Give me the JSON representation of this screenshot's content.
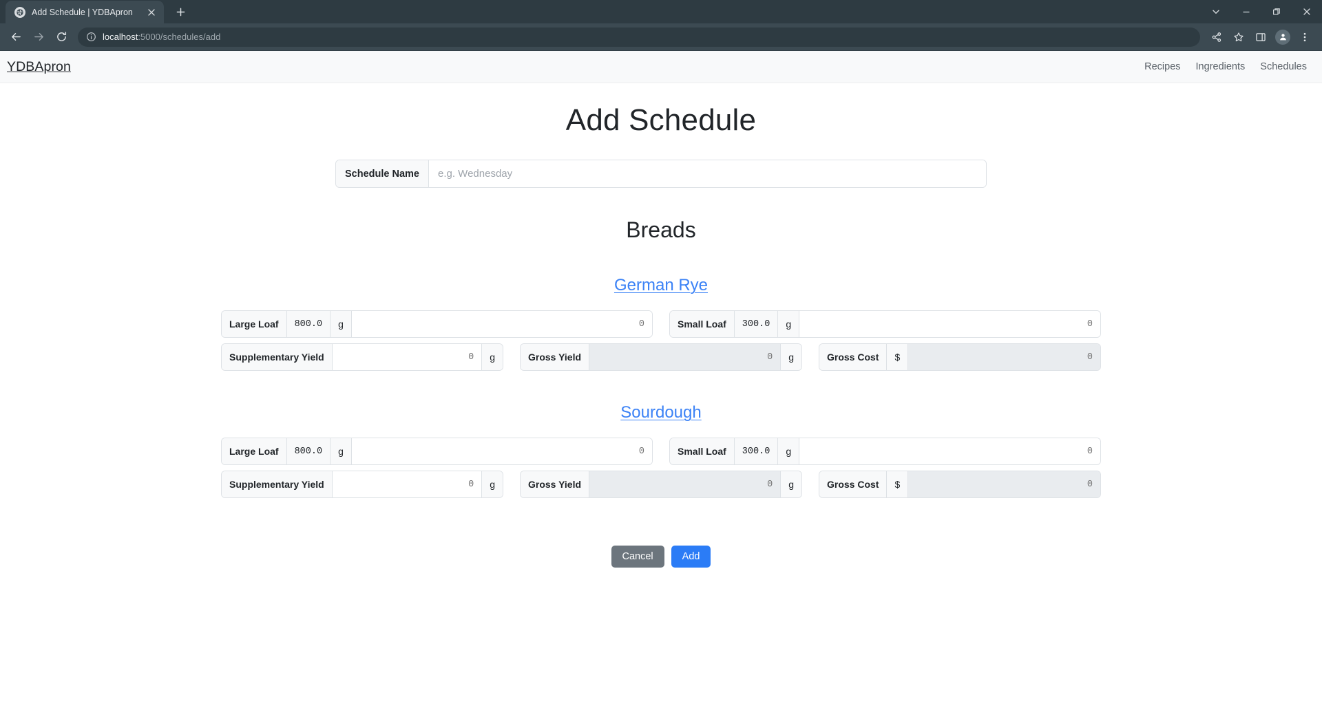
{
  "browser": {
    "tab": {
      "title": "Add Schedule | YDBApron",
      "favicon_icon": "globe-icon",
      "close_icon": "close-icon"
    },
    "new_tab_icon": "plus-icon",
    "window_controls": [
      {
        "name": "tab-search",
        "icon": "chevron-down-icon"
      },
      {
        "name": "minimize",
        "icon": "minimize-icon"
      },
      {
        "name": "maximize",
        "icon": "restore-icon"
      },
      {
        "name": "close",
        "icon": "close-icon"
      }
    ],
    "nav_buttons": [
      {
        "name": "back",
        "icon": "arrow-left-icon"
      },
      {
        "name": "forward",
        "icon": "arrow-right-icon"
      },
      {
        "name": "reload",
        "icon": "reload-icon"
      }
    ],
    "omnibox": {
      "info_icon": "info-circle-icon",
      "host": "localhost",
      "path": ":5000/schedules/add",
      "full_url": "localhost:5000/schedules/add"
    },
    "toolbar_right": [
      {
        "name": "share",
        "icon": "share-icon"
      },
      {
        "name": "bookmark",
        "icon": "star-icon"
      },
      {
        "name": "side-panel",
        "icon": "side-panel-icon"
      },
      {
        "name": "profile",
        "icon": "person-icon"
      },
      {
        "name": "menu",
        "icon": "three-dots-vertical-icon"
      }
    ]
  },
  "navbar": {
    "brand": "YDBApron",
    "links": [
      {
        "label": "Recipes"
      },
      {
        "label": "Ingredients"
      },
      {
        "label": "Schedules"
      }
    ]
  },
  "main": {
    "page_title": "Add Schedule",
    "schedule_name": {
      "label": "Schedule Name",
      "value": "",
      "placeholder": "e.g. Wednesday"
    },
    "section_title": "Breads",
    "units": {
      "grams": "g",
      "dollars": "$"
    },
    "recipes": [
      {
        "name": "German Rye",
        "large_loaf": {
          "label": "Large Loaf",
          "weight": "800.0",
          "unit": "g",
          "value": "",
          "placeholder": "0"
        },
        "small_loaf": {
          "label": "Small Loaf",
          "weight": "300.0",
          "unit": "g",
          "value": "",
          "placeholder": "0"
        },
        "supplementary_yield": {
          "label": "Supplementary Yield",
          "unit": "g",
          "value": "",
          "placeholder": "0"
        },
        "gross_yield": {
          "label": "Gross Yield",
          "unit": "g",
          "value": "",
          "placeholder": "0",
          "disabled": true
        },
        "gross_cost": {
          "label": "Gross Cost",
          "unit": "$",
          "value": "",
          "placeholder": "0",
          "disabled": true
        }
      },
      {
        "name": "Sourdough",
        "large_loaf": {
          "label": "Large Loaf",
          "weight": "800.0",
          "unit": "g",
          "value": "",
          "placeholder": "0"
        },
        "small_loaf": {
          "label": "Small Loaf",
          "weight": "300.0",
          "unit": "g",
          "value": "",
          "placeholder": "0"
        },
        "supplementary_yield": {
          "label": "Supplementary Yield",
          "unit": "g",
          "value": "",
          "placeholder": "0"
        },
        "gross_yield": {
          "label": "Gross Yield",
          "unit": "g",
          "value": "",
          "placeholder": "0",
          "disabled": true
        },
        "gross_cost": {
          "label": "Gross Cost",
          "unit": "$",
          "value": "",
          "placeholder": "0",
          "disabled": true
        }
      }
    ],
    "actions": {
      "cancel_label": "Cancel",
      "add_label": "Add"
    }
  },
  "colors": {
    "accent_blue": "#2b7cf6",
    "link_blue": "#3b82f6",
    "cancel_grey": "#6c757d",
    "navbar_bg": "#f8f9fa",
    "chrome_bg": "#3c4a52",
    "tabstrip_bg": "#2e3b42",
    "input_border": "#dee2e6",
    "disabled_bg": "#e9ecef"
  }
}
